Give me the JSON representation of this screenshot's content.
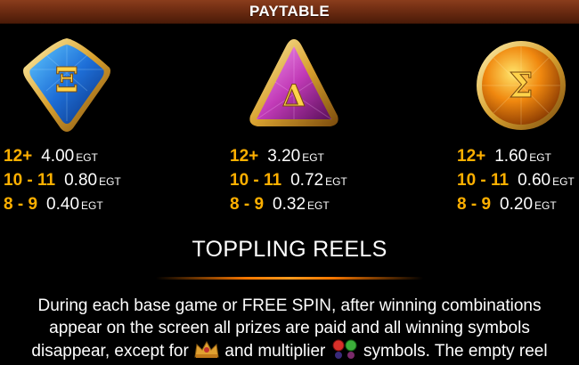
{
  "header": {
    "title": "PAYTABLE"
  },
  "symbols": [
    {
      "name": "xi-gem",
      "glyph": "Ξ",
      "color": "#1e6fd8",
      "rows": [
        {
          "range": "12+",
          "value": "4.00",
          "unit": "EGT"
        },
        {
          "range": "10 - 11",
          "value": "0.80",
          "unit": "EGT"
        },
        {
          "range": "8 - 9",
          "value": "0.40",
          "unit": "EGT"
        }
      ]
    },
    {
      "name": "delta-gem",
      "glyph": "Δ",
      "color": "#c23bb8",
      "rows": [
        {
          "range": "12+",
          "value": "3.20",
          "unit": "EGT"
        },
        {
          "range": "10 - 11",
          "value": "0.72",
          "unit": "EGT"
        },
        {
          "range": "8 - 9",
          "value": "0.32",
          "unit": "EGT"
        }
      ]
    },
    {
      "name": "sigma-gem",
      "glyph": "Σ",
      "color": "#f0880f",
      "rows": [
        {
          "range": "12+",
          "value": "1.60",
          "unit": "EGT"
        },
        {
          "range": "10 - 11",
          "value": "0.60",
          "unit": "EGT"
        },
        {
          "range": "8 - 9",
          "value": "0.20",
          "unit": "EGT"
        }
      ]
    }
  ],
  "section": {
    "title": "TOPPLING REELS",
    "line1": "During each base game or FREE SPIN, after winning combinations",
    "line2": "appear on the screen all prizes are paid and all winning symbols",
    "line3a": "disappear, except for",
    "line3b": "and multiplier",
    "line3c": "symbols. The empty reel",
    "icons": [
      "scatter-crown-icon",
      "multiplier-gems-icon"
    ]
  }
}
